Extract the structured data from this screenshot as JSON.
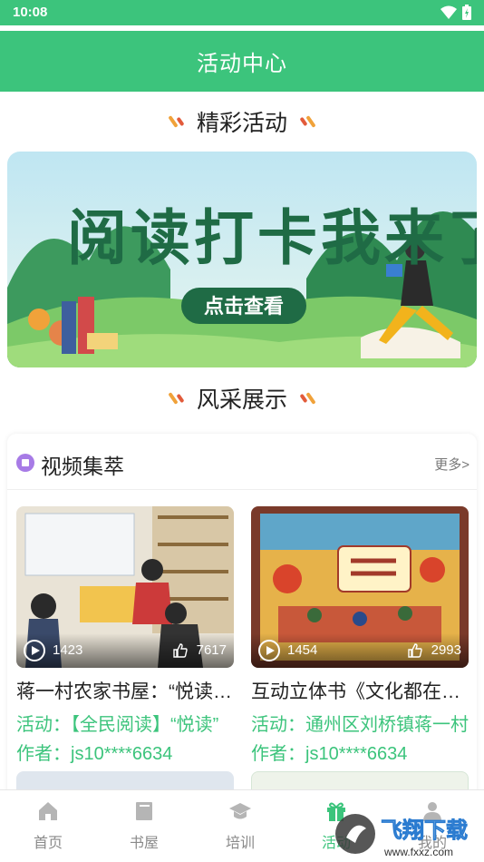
{
  "status_bar": {
    "time": "10:08"
  },
  "header": {
    "title": "活动中心"
  },
  "sections": {
    "featured_title": "精彩活动",
    "showcase_title": "风采展示"
  },
  "banner": {
    "headline": "阅读打卡我来了",
    "button_label": "点击查看"
  },
  "video_card": {
    "title": "视频集萃",
    "more_label": "更多>",
    "items": [
      {
        "play_count": "1423",
        "like_count": "7617",
        "title": "蒋一村农家书屋：“悦读”农家书屋 ",
        "activity": "活动：【全民阅读】“悦读”",
        "author": "作者：js10****6634"
      },
      {
        "play_count": "1454",
        "like_count": "2993",
        "title": "互动立体书《文化都在节日里》",
        "activity": "活动：通州区刘桥镇蒋一村",
        "author": "作者：js10****6634"
      }
    ]
  },
  "bottom_nav": {
    "items": [
      {
        "label": "首页",
        "icon": "home-icon"
      },
      {
        "label": "书屋",
        "icon": "book-icon"
      },
      {
        "label": "培训",
        "icon": "graduation-cap-icon"
      },
      {
        "label": "活动",
        "icon": "gift-icon"
      },
      {
        "label": "我的",
        "icon": "person-icon"
      }
    ],
    "active_index": 3
  },
  "watermark": {
    "text": "飞翔下载",
    "url_text": "www.fxxz.com"
  },
  "colors": {
    "accent": "#3cc47c",
    "title_text": "#222222",
    "muted": "#8a8a8a"
  }
}
